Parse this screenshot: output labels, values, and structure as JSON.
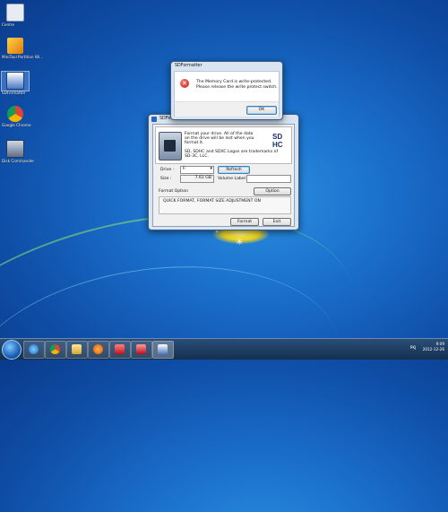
{
  "desktop": {
    "icons": [
      {
        "label": "Centre"
      },
      {
        "label": "MiniTool Partition Wi..."
      },
      {
        "label": "SDFormatter"
      },
      {
        "label": "Google Chrome"
      },
      {
        "label": "Disk Commander"
      }
    ]
  },
  "error_dialog": {
    "title": "SDFormatter",
    "message_line1": "The Memory Card is write-protected.",
    "message_line2": "Please release the write protect switch.",
    "ok_label": "OK"
  },
  "main_window": {
    "title": "SDFo",
    "info_line1": "Format your drive. All of the data",
    "info_line2": "on the drive will be lost when you",
    "info_line3": "format it.",
    "logo_text": "SD HC",
    "trademark_line1": "SD, SDHC and SDXC Logos are trademarks of",
    "trademark_line2": "SD-3C, LLC.",
    "drive_label": "Drive :",
    "drive_value": "F:",
    "refresh_label": "Refresh",
    "size_label": "Size :",
    "size_value": "7.61 GB",
    "volume_label": "Volume Label :",
    "volume_value": "",
    "format_option_label": "Format Option",
    "option_label": "Option",
    "format_option_text": "QUICK FORMAT, FORMAT SIZE ADJUSTMENT ON",
    "format_label": "Format",
    "exit_label": "Exit"
  },
  "taskbar": {
    "buttons": [
      "ie-icon",
      "chrome-icon",
      "explorer-icon",
      "windows-media-icon",
      "network-icon",
      "app-icon",
      "sdformatter-icon"
    ],
    "lang": "PKJ",
    "time": "9:09",
    "date": "2012-12-26"
  }
}
